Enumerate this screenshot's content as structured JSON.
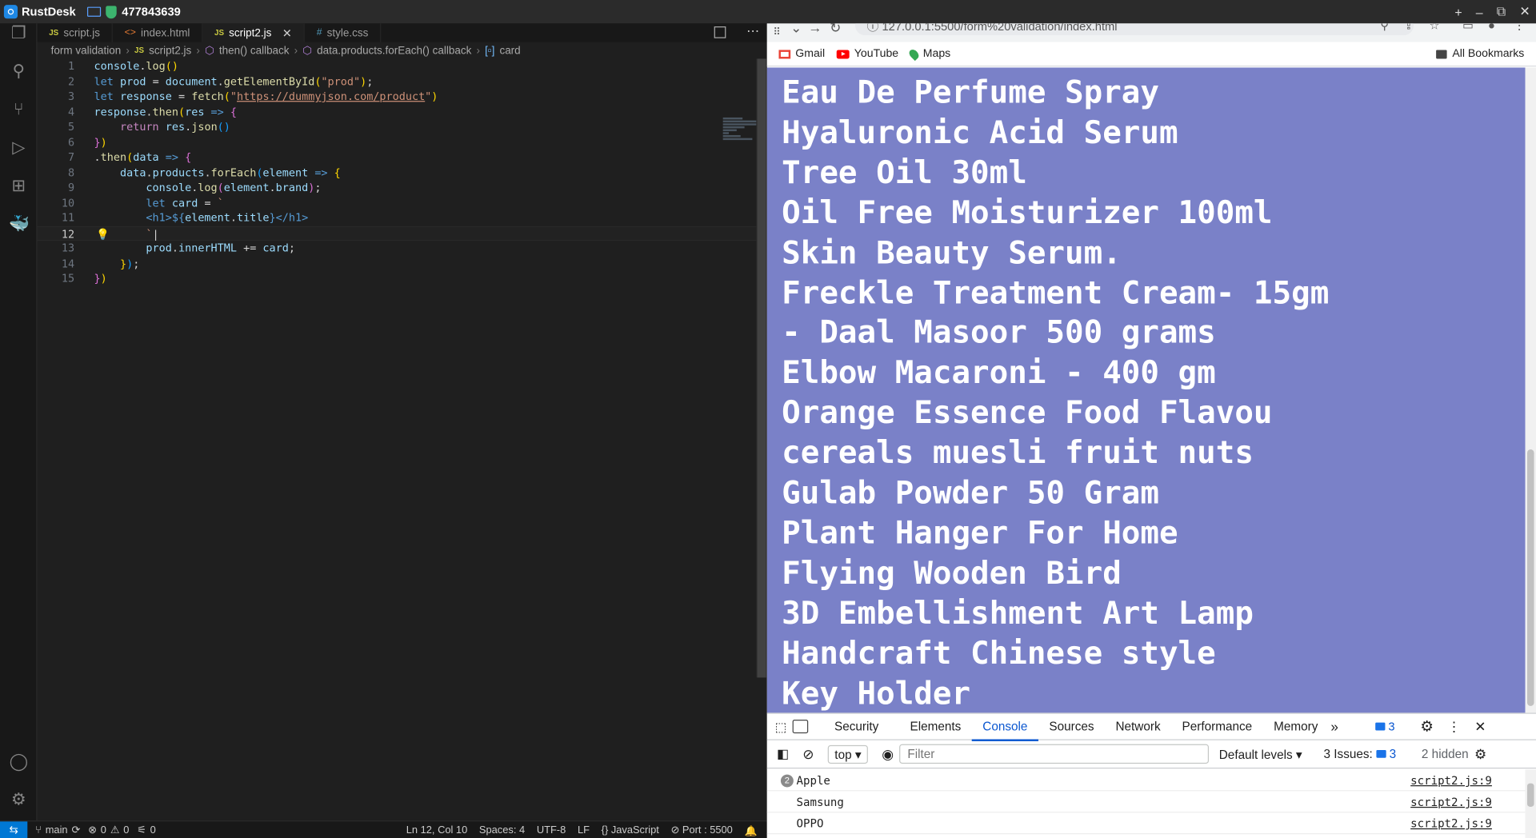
{
  "titlebar": {
    "app": "RustDesk",
    "id": "477843639",
    "controls": [
      "+",
      "–",
      "⧉",
      "✕"
    ]
  },
  "vscode": {
    "tabs": [
      {
        "label": "script.js",
        "type": "JS"
      },
      {
        "label": "index.html",
        "type": "<>"
      },
      {
        "label": "script2.js",
        "type": "JS",
        "active": true
      },
      {
        "label": "style.css",
        "type": "#"
      }
    ],
    "breadcrumb": [
      "form validation",
      "script2.js",
      "then() callback",
      "data.products.forEach() callback",
      "card"
    ],
    "current_line": 12,
    "status": {
      "branch": "main",
      "problems": "0",
      "warnings": "0",
      "ports": "0",
      "position": "Ln 12, Col 10",
      "spaces": "Spaces: 4",
      "encoding": "UTF-8",
      "eol": "LF",
      "language": "JavaScript",
      "port": "Port : 5500"
    }
  },
  "chrome": {
    "address": "127.0.0.1:5500/form%20validation/index.html",
    "bookmarks": [
      "Gmail",
      "YouTube",
      "Maps"
    ],
    "all_bookmarks": "All Bookmarks",
    "products": [
      "Eau De Perfume Spray",
      "Hyaluronic Acid Serum",
      "Tree Oil 30ml",
      "Oil Free Moisturizer 100ml",
      "Skin Beauty Serum.",
      "Freckle Treatment Cream- 15gm",
      "- Daal Masoor 500 grams",
      "Elbow Macaroni - 400 gm",
      "Orange Essence Food Flavou",
      "cereals muesli fruit nuts",
      "Gulab Powder 50 Gram",
      "Plant Hanger For Home",
      "Flying Wooden Bird",
      "3D Embellishment Art Lamp",
      "Handcraft Chinese style",
      "Key Holder"
    ],
    "page_bg": "#7a81c8",
    "devtools": {
      "tabs": [
        "Security",
        "Elements",
        "Console",
        "Sources",
        "Network",
        "Performance",
        "Memory"
      ],
      "active_tab": "Console",
      "issue_badge": "3",
      "context": "top",
      "filter_placeholder": "Filter",
      "levels": "Default levels",
      "issues_label": "3 Issues:",
      "issues_count": "3",
      "hidden": "2 hidden",
      "logs": [
        {
          "count": "2",
          "text": "Apple",
          "source": "script2.js:9"
        },
        {
          "count": "",
          "text": "Samsung",
          "source": "script2.js:9"
        },
        {
          "count": "",
          "text": "OPPO",
          "source": "script2.js:9"
        }
      ]
    }
  }
}
